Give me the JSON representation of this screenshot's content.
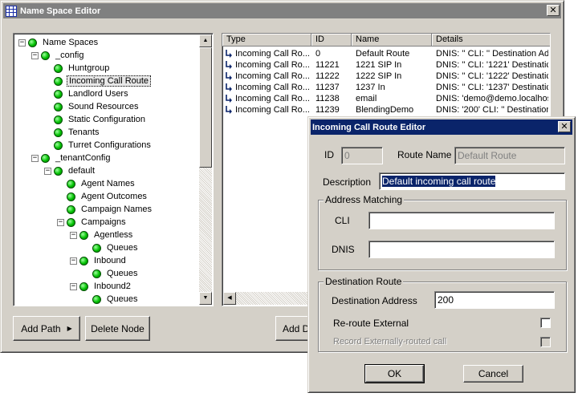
{
  "main_window": {
    "title": "Name Space Editor",
    "close_glyph": "✕"
  },
  "tree": {
    "nodes": [
      {
        "label": "Name Spaces",
        "expander": "−"
      },
      {
        "label": "_config",
        "expander": "−"
      },
      {
        "label": "Huntgroup"
      },
      {
        "label": "Incoming Call Route",
        "selected": true
      },
      {
        "label": "Landlord Users"
      },
      {
        "label": "Sound Resources"
      },
      {
        "label": "Static Configuration"
      },
      {
        "label": "Tenants"
      },
      {
        "label": "Turret Configurations"
      },
      {
        "label": "_tenantConfig",
        "expander": "−"
      },
      {
        "label": "default",
        "expander": "−"
      },
      {
        "label": "Agent Names"
      },
      {
        "label": "Agent Outcomes"
      },
      {
        "label": "Campaign Names"
      },
      {
        "label": "Campaigns",
        "expander": "−"
      },
      {
        "label": "Agentless",
        "expander": "−"
      },
      {
        "label": "Queues"
      },
      {
        "label": "Inbound",
        "expander": "−"
      },
      {
        "label": "Queues"
      },
      {
        "label": "Inbound2",
        "expander": "−"
      },
      {
        "label": "Queues"
      }
    ]
  },
  "buttons": {
    "add_path": "Add Path",
    "delete_node": "Delete Node",
    "add_data": "Add Da"
  },
  "table": {
    "columns": [
      "Type",
      "ID",
      "Name",
      "Details"
    ],
    "rows": [
      {
        "type": "Incoming Call Ro...",
        "id": "0",
        "name": "Default Route",
        "details": "DNIS: '' CLI: '' Destination Ad"
      },
      {
        "type": "Incoming Call Ro...",
        "id": "11221",
        "name": "1221 SIP In",
        "details": "DNIS: '' CLI: '1221' Destinatic"
      },
      {
        "type": "Incoming Call Ro...",
        "id": "11222",
        "name": "1222 SIP In",
        "details": "DNIS: '' CLI: '1222' Destinatic"
      },
      {
        "type": "Incoming Call Ro...",
        "id": "11237",
        "name": "1237 In",
        "details": "DNIS: '' CLI: '1237' Destinatic"
      },
      {
        "type": "Incoming Call Ro...",
        "id": "11238",
        "name": "email",
        "details": "DNIS: 'demo@demo.localhos"
      },
      {
        "type": "Incoming Call Ro...",
        "id": "11239",
        "name": "BlendingDemo",
        "details": "DNIS: '200' CLI: '' Destination"
      }
    ]
  },
  "dialog": {
    "title": "Incoming Call Route Editor",
    "close_glyph": "✕",
    "id_label": "ID",
    "id_value": "0",
    "route_name_label": "Route Name",
    "route_name_value": "Default Route",
    "description_label": "Description",
    "description_value": "Default incoming call route",
    "address_group": "Address Matching",
    "cli_label": "CLI",
    "cli_value": "",
    "dnis_label": "DNIS",
    "dnis_value": "",
    "dest_group": "Destination Route",
    "dest_address_label": "Destination Address",
    "dest_address_value": "200",
    "reroute_label": "Re-route External",
    "record_label": "Record Externally-routed call",
    "ok": "OK",
    "cancel": "Cancel"
  },
  "colors": {
    "active_title": "#0a246a",
    "inactive_title": "#808080",
    "face": "#d4d0c8",
    "node_dot": "#00c000"
  }
}
